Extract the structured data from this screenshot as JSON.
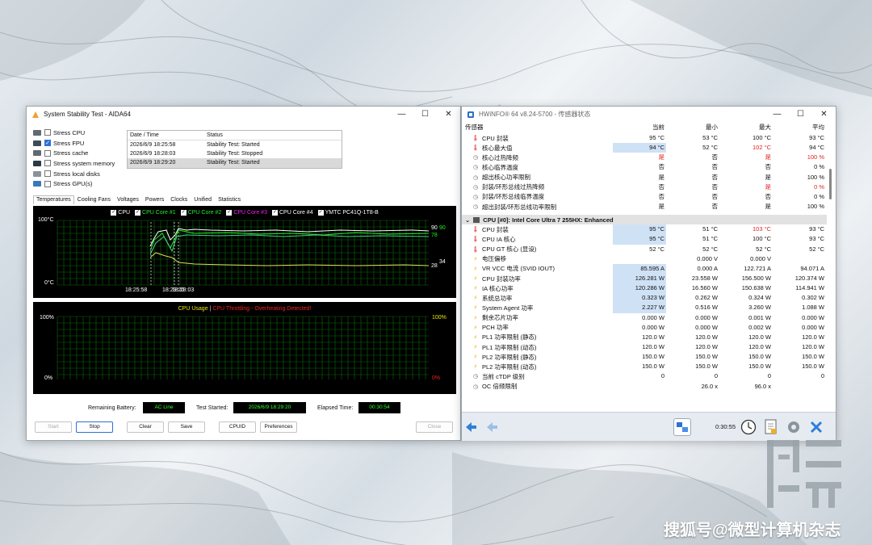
{
  "aida": {
    "title": "System Stability Test - AIDA64",
    "stress_items": [
      {
        "label": "Stress CPU",
        "checked": false
      },
      {
        "label": "Stress FPU",
        "checked": true
      },
      {
        "label": "Stress cache",
        "checked": false
      },
      {
        "label": "Stress system memory",
        "checked": false
      },
      {
        "label": "Stress local disks",
        "checked": false
      },
      {
        "label": "Stress GPU(s)",
        "checked": false
      }
    ],
    "log": {
      "headers": [
        "Date / Time",
        "Status"
      ],
      "rows": [
        [
          "2026/6/9 18:25:58",
          "Stability Test: Started"
        ],
        [
          "2026/6/9 18:28:03",
          "Stability Test: Stopped"
        ],
        [
          "2026/6/9 18:29:20",
          "Stability Test: Started"
        ]
      ]
    },
    "tabs": [
      "Temperatures",
      "Cooling Fans",
      "Voltages",
      "Powers",
      "Clocks",
      "Unified",
      "Statistics"
    ],
    "temp_graph": {
      "legend": [
        {
          "label": "CPU",
          "color": "#ffffff"
        },
        {
          "label": "CPU Core #1",
          "color": "#22ee22"
        },
        {
          "label": "CPU Core #2",
          "color": "#22ee22"
        },
        {
          "label": "CPU Core #3",
          "color": "#ee22ee"
        },
        {
          "label": "CPU Core #4",
          "color": "#ffffff"
        },
        {
          "label": "YMTC PC41Q-1T8-B",
          "color": "#ffffff"
        }
      ],
      "y_top": "100°C",
      "y_bottom": "0°C",
      "x_labels": [
        "18:25:58",
        "18:29:20",
        "18:28:03"
      ],
      "right_values": [
        "90",
        "90",
        "78",
        "34",
        "28"
      ]
    },
    "usage_graph": {
      "title_usage": "CPU Usage",
      "separator": "|",
      "title_throttle": "CPU Throttling - Overheating Detected!",
      "left_top": "100%",
      "left_bottom": "0%",
      "right_top": "100%",
      "right_bottom": "0%"
    },
    "status": {
      "battery_label": "Remaining Battery:",
      "battery_value": "AC Line",
      "started_label": "Test Started:",
      "started_value": "2026/6/9 18:29:20",
      "elapsed_label": "Elapsed Time:",
      "elapsed_value": "00:30:54"
    },
    "buttons": [
      "Start",
      "Stop",
      "Clear",
      "Save",
      "CPUID",
      "Preferences",
      "Close"
    ]
  },
  "hwinfo": {
    "title": "HWiNFO® 64 v8.24-5700 - 传感器状态",
    "headers": [
      "传感器",
      "当前",
      "最小",
      "最大",
      "平均"
    ],
    "rows": [
      {
        "icon": "thermo",
        "label": "CPU 封装",
        "v": [
          "95 °C",
          "53 °C",
          "100 °C",
          "93 °C"
        ],
        "hl": false
      },
      {
        "icon": "thermo",
        "label": "核心最大值",
        "v": [
          "94 °C",
          "52 °C",
          "102 °C",
          "94 °C"
        ],
        "hl": true,
        "red": [
          false,
          false,
          true,
          false
        ]
      },
      {
        "icon": "clock",
        "label": "核心过热降频",
        "v": [
          "是",
          "否",
          "是",
          "100 %"
        ],
        "red": [
          true,
          false,
          true,
          true
        ]
      },
      {
        "icon": "clock",
        "label": "核心临界温度",
        "v": [
          "否",
          "否",
          "否",
          "0 %"
        ]
      },
      {
        "icon": "clock",
        "label": "超出核心功率限制",
        "v": [
          "是",
          "否",
          "是",
          "100 %"
        ]
      },
      {
        "icon": "clock",
        "label": "封装/环形总线过热降频",
        "v": [
          "否",
          "否",
          "是",
          "0 %"
        ],
        "red": [
          false,
          false,
          true,
          true
        ]
      },
      {
        "icon": "clock",
        "label": "封装/环形总线临界温度",
        "v": [
          "否",
          "否",
          "否",
          "0 %"
        ]
      },
      {
        "icon": "clock",
        "label": "超出封装/环形总线功率限制",
        "v": [
          "是",
          "否",
          "是",
          "100 %"
        ]
      }
    ],
    "group": "CPU [#0]: Intel Core Ultra 7 255HX: Enhanced",
    "rows2": [
      {
        "icon": "thermo",
        "label": "CPU 封装",
        "v": [
          "95 °C",
          "51 °C",
          "103 °C",
          "93 °C"
        ],
        "hl": true,
        "red": [
          false,
          false,
          true,
          false
        ]
      },
      {
        "icon": "thermo",
        "label": "CPU IA 核心",
        "v": [
          "95 °C",
          "51 °C",
          "100 °C",
          "93 °C"
        ],
        "hl": true
      },
      {
        "icon": "thermo",
        "label": "CPU GT 核心 (显设)",
        "v": [
          "52 °C",
          "52 °C",
          "52 °C",
          "52 °C"
        ]
      },
      {
        "icon": "bolt",
        "label": "电压偏移",
        "v": [
          "",
          "0.000 V",
          "0.000 V",
          ""
        ]
      },
      {
        "icon": "bolt",
        "label": "VR VCC 电流 (SVID IOUT)",
        "v": [
          "85.595 A",
          "0.000 A",
          "122.721 A",
          "94.071 A"
        ],
        "hl": true
      },
      {
        "icon": "bolt",
        "label": "CPU 封装功率",
        "v": [
          "126.281 W",
          "23.558 W",
          "156.500 W",
          "120.374 W"
        ],
        "hl": true
      },
      {
        "icon": "bolt",
        "label": "IA 核心功率",
        "v": [
          "120.286 W",
          "16.560 W",
          "150.638 W",
          "114.941 W"
        ],
        "hl": true
      },
      {
        "icon": "bolt",
        "label": "系统总功率",
        "v": [
          "0.323 W",
          "0.262 W",
          "0.324 W",
          "0.302 W"
        ],
        "hl": true
      },
      {
        "icon": "bolt",
        "label": "System Agent 功率",
        "v": [
          "2.227 W",
          "0.516 W",
          "3.260 W",
          "1.088 W"
        ],
        "hl": true
      },
      {
        "icon": "bolt",
        "label": "剩余芯片功率",
        "v": [
          "0.000 W",
          "0.000 W",
          "0.001 W",
          "0.000 W"
        ]
      },
      {
        "icon": "bolt",
        "label": "PCH 功率",
        "v": [
          "0.000 W",
          "0.000 W",
          "0.002 W",
          "0.000 W"
        ]
      },
      {
        "icon": "bolt",
        "label": "PL1 功率限制 (静态)",
        "v": [
          "120.0 W",
          "120.0 W",
          "120.0 W",
          "120.0 W"
        ]
      },
      {
        "icon": "bolt",
        "label": "PL1 功率限制 (动态)",
        "v": [
          "120.0 W",
          "120.0 W",
          "120.0 W",
          "120.0 W"
        ]
      },
      {
        "icon": "bolt",
        "label": "PL2 功率限制 (静态)",
        "v": [
          "150.0 W",
          "150.0 W",
          "150.0 W",
          "150.0 W"
        ]
      },
      {
        "icon": "bolt",
        "label": "PL2 功率限制 (动态)",
        "v": [
          "150.0 W",
          "150.0 W",
          "150.0 W",
          "150.0 W"
        ]
      },
      {
        "icon": "clock",
        "label": "当前 cTDP 级别",
        "v": [
          "0",
          "0",
          "0",
          "0"
        ]
      },
      {
        "icon": "clock",
        "label": "OC 倍频限制",
        "v": [
          "",
          "26.0 x",
          "96.0 x",
          ""
        ]
      }
    ],
    "timer": "0:30:55"
  },
  "watermark": "搜狐号@微型计算机杂志"
}
